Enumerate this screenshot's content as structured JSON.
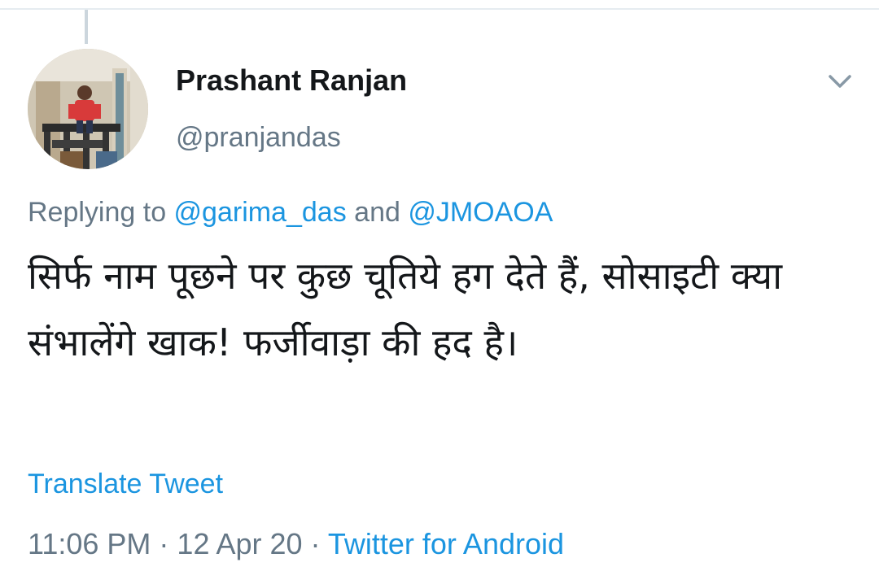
{
  "tweet": {
    "display_name": "Prashant Ranjan",
    "handle": "@pranjandas",
    "reply_prefix": "Replying to ",
    "reply_user_1": "@garima_das",
    "reply_joiner": " and ",
    "reply_user_2": "@JMOAOA",
    "text": "सिर्फ नाम पूछने पर कुछ चूतिये हग देते हैं, सोसाइटी क्या संभालेंगे खाक! फर्जीवाड़ा की हद है।",
    "translate_label": "Translate Tweet",
    "time": "11:06 PM",
    "separator": " · ",
    "date": "12 Apr 20",
    "source": "Twitter for Android"
  },
  "icons": {
    "menu": "chevron-down-icon",
    "avatar": "avatar-photo"
  },
  "colors": {
    "link": "#1b95e0",
    "secondary_text": "#657786",
    "primary_text": "#14171a",
    "thread_line": "#ccd6dd"
  }
}
